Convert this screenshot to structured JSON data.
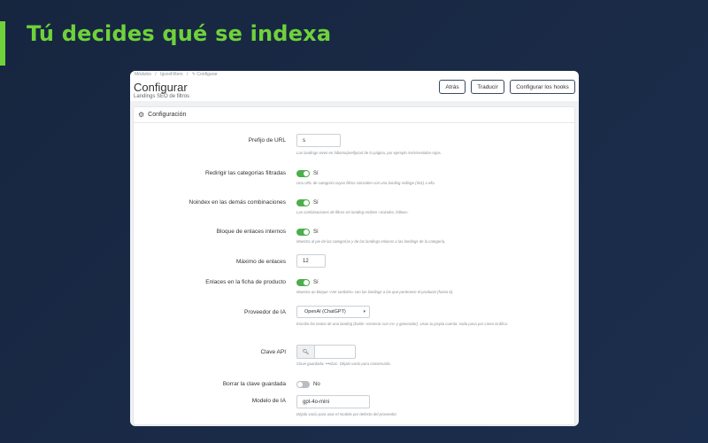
{
  "hero": {
    "title": "Tú decides qué se indexa"
  },
  "breadcrumb": [
    "Módulos",
    "/",
    "IgsoxFilters",
    "/",
    "✎ Configurar"
  ],
  "header": {
    "title": "Configurar",
    "subtitle": "Landings SEO de filtros",
    "buttons": {
      "back": "Atrás",
      "translate": "Traducir",
      "hooks": "Configurar los hooks"
    }
  },
  "card": {
    "title": "Configuración"
  },
  "form": {
    "url_prefix": {
      "label": "Prefijo de URL",
      "value": "s",
      "help": "Las landings viven en /idioma/prefijo/url de la página, por ejemplo /es/s/vestidos-rojos."
    },
    "redirect": {
      "label": "Redirigir las categorías filtradas",
      "state": "Sí",
      "help": "Una URL de categoría cuyos filtros coinciden con una landing redirige (301) a ella."
    },
    "noindex": {
      "label": "Noindex en las demás combinaciones",
      "state": "Sí",
      "help": "Las combinaciones de filtros sin landing reciben «noindex, follow»."
    },
    "links_block": {
      "label": "Bloque de enlaces internos",
      "state": "Sí",
      "help": "Muestra al pie de las categorías y de las landings enlaces a las landings de la categoría."
    },
    "max_links": {
      "label": "Máximo de enlaces",
      "value": "12"
    },
    "product_links": {
      "label": "Enlaces en la ficha de producto",
      "state": "Sí",
      "help": "Muestra un bloque «Ver también» con las landings a las que pertenece el producto (hasta 6)."
    },
    "ai_provider": {
      "label": "Proveedor de IA",
      "value": "OpenAI (ChatGPT)",
      "help": "Escribe los textos de una landing (botón «Generar con IA» y generador). Usas tu propia cuenta: nada pasa por Linea Gráfica."
    },
    "api_key": {
      "label": "Clave API",
      "help": "Clave guardada: •••sb1c. Déjalo vacío para conservarla."
    },
    "clear_key": {
      "label": "Borrar la clave guardada",
      "state": "No"
    },
    "ai_model": {
      "label": "Modelo de IA",
      "value": "gpt-4o-mini",
      "help": "Déjalo vacío para usar el modelo por defecto del proveedor."
    }
  },
  "colors": {
    "accent": "#6fd23a",
    "toggle_on": "#4cae4c",
    "background": "#17263f"
  }
}
